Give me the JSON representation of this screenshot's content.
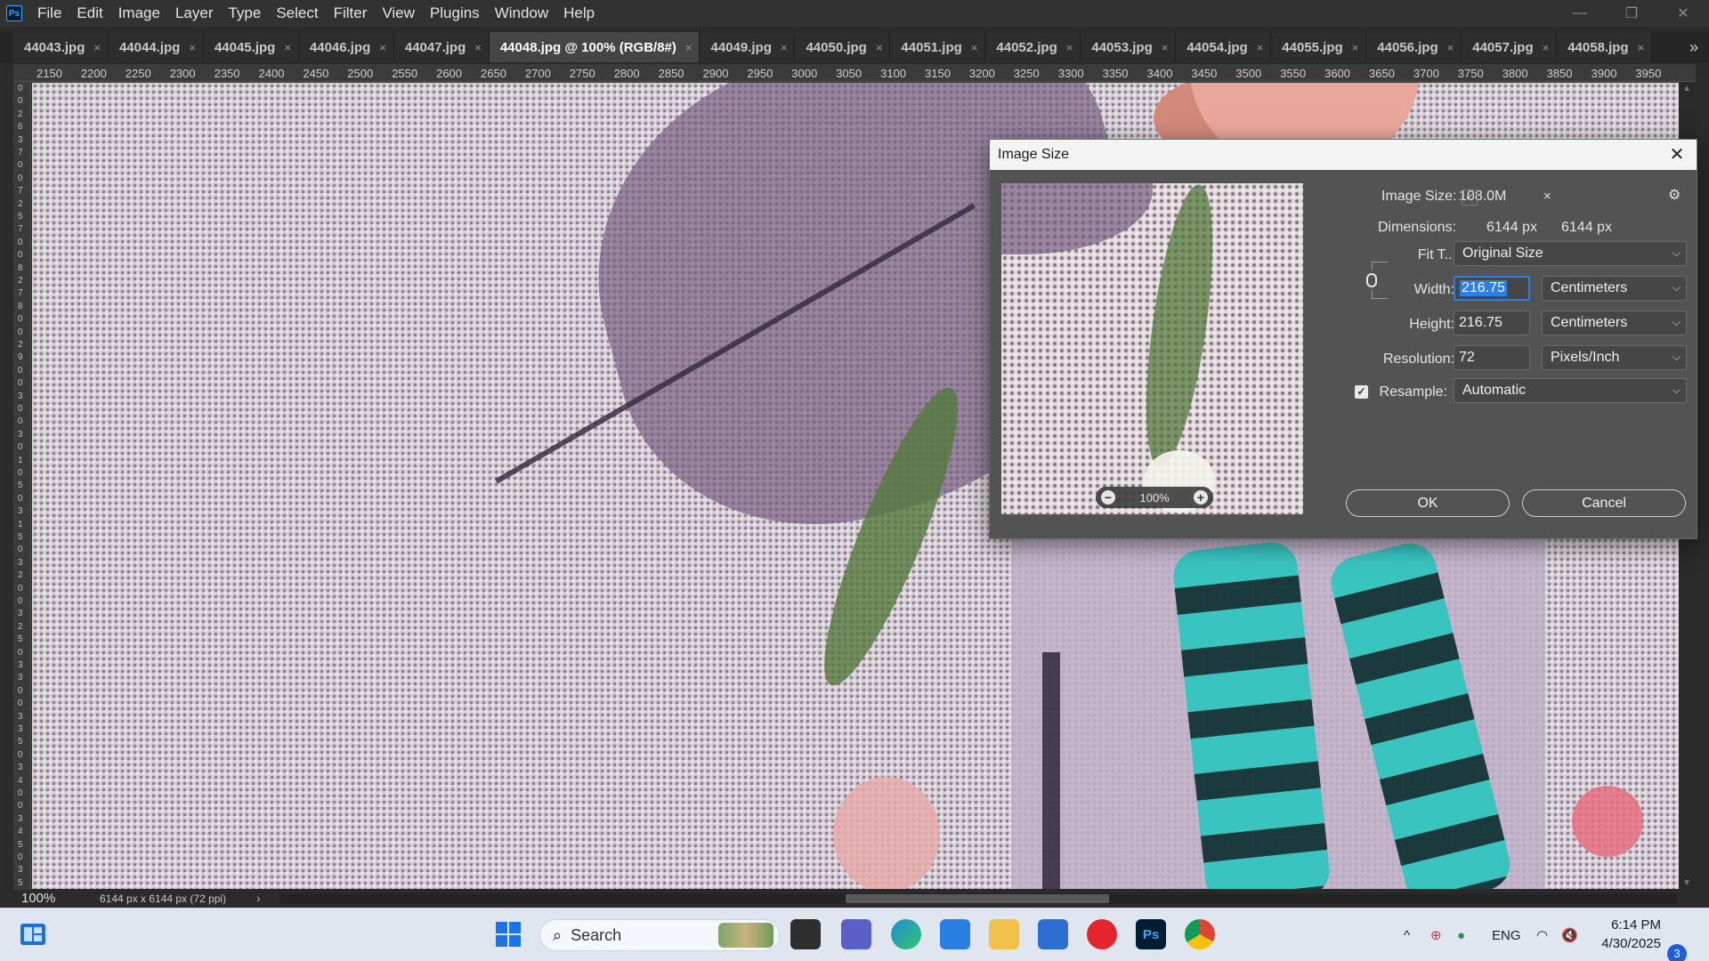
{
  "app": {
    "logo": "Ps"
  },
  "menu": [
    "File",
    "Edit",
    "Image",
    "Layer",
    "Type",
    "Select",
    "Filter",
    "View",
    "Plugins",
    "Window",
    "Help"
  ],
  "window_controls": {
    "minimize": "—",
    "restore": "❐",
    "close": "✕"
  },
  "tabs": [
    {
      "label": "44043.jpg",
      "active": false
    },
    {
      "label": "44044.jpg",
      "active": false
    },
    {
      "label": "44045.jpg",
      "active": false
    },
    {
      "label": "44046.jpg",
      "active": false
    },
    {
      "label": "44047.jpg",
      "active": false
    },
    {
      "label": "44048.jpg @ 100% (RGB/8#)",
      "active": true
    },
    {
      "label": "44049.jpg",
      "active": false
    },
    {
      "label": "44050.jpg",
      "active": false
    },
    {
      "label": "44051.jpg",
      "active": false
    },
    {
      "label": "44052.jpg",
      "active": false
    },
    {
      "label": "44053.jpg",
      "active": false
    },
    {
      "label": "44054.jpg",
      "active": false
    },
    {
      "label": "44055.jpg",
      "active": false
    },
    {
      "label": "44056.jpg",
      "active": false
    },
    {
      "label": "44057.jpg",
      "active": false
    },
    {
      "label": "44058.jpg",
      "active": false
    }
  ],
  "tab_overflow": "»",
  "tab_close": "×",
  "ruler_top": [
    "2150",
    "2200",
    "2250",
    "2300",
    "2350",
    "2400",
    "2450",
    "2500",
    "2550",
    "2600",
    "2650",
    "2700",
    "2750",
    "2800",
    "2850",
    "2900",
    "2950",
    "3000",
    "3050",
    "3100",
    "3150",
    "3200",
    "3250",
    "3300",
    "3350",
    "3400",
    "3450",
    "3500",
    "3550",
    "3600",
    "3650",
    "3700",
    "3750",
    "3800",
    "3850",
    "3900",
    "3950"
  ],
  "ruler_left_digits": [
    "0",
    "0",
    "2",
    "6",
    "3",
    "7",
    "0",
    "0",
    "7",
    "2",
    "5",
    "7",
    "0",
    "0",
    "8",
    "2",
    "7",
    "8",
    "0",
    "0",
    "2",
    "9",
    "0",
    "0",
    "3",
    "0",
    "0",
    "3",
    "0",
    "1",
    "0",
    "5",
    "0",
    "3",
    "1",
    "5",
    "0",
    "3",
    "2",
    "0",
    "0",
    "3",
    "2",
    "5",
    "0",
    "3",
    "3",
    "0",
    "0",
    "3",
    "3",
    "5",
    "0",
    "3",
    "4",
    "0",
    "0",
    "3",
    "4",
    "5",
    "0",
    "3",
    "5"
  ],
  "status": {
    "zoom": "100%",
    "doc_info": "6144 px x 6144 px (72 ppi)",
    "arrow": "›"
  },
  "dialog": {
    "title": "Image Size",
    "close": "✕",
    "image_size_label": "Image Size:",
    "image_size_value": "108.0M",
    "gear": "⚙",
    "dimensions_label": "Dimensions:",
    "dimensions_toggle": "✓",
    "dim_width": "6144 px",
    "dim_times": "×",
    "dim_height": "6144 px",
    "fit_label": "Fit T...",
    "fit_value": "Original Size",
    "width_label": "Width:",
    "width_value": "216.75",
    "width_unit": "Centimeters",
    "height_label": "Height:",
    "height_value": "216.75",
    "height_unit": "Centimeters",
    "resolution_label": "Resolution:",
    "resolution_value": "72",
    "resolution_unit": "Pixels/Inch",
    "resample_label": "Resample:",
    "resample_checked": "✓",
    "resample_value": "Automatic",
    "preview_zoom": "100%",
    "zoom_out": "−",
    "zoom_in": "+",
    "ok": "OK",
    "cancel": "Cancel",
    "chevron": "⌵"
  },
  "taskbar": {
    "search_placeholder": "Search",
    "search_icon": "⌕",
    "ps_label": "Ps",
    "tray_chevron": "^",
    "lang": "ENG",
    "wifi": "◠",
    "volume": "🔇",
    "time": "6:14 PM",
    "date": "4/30/2025",
    "notifications": "3"
  },
  "colors": {
    "accent_blue": "#2f7ee3",
    "ps_blue": "#31a8ff",
    "dialog_bg": "#535353",
    "taskbar_bg": "#dfe6f0"
  }
}
